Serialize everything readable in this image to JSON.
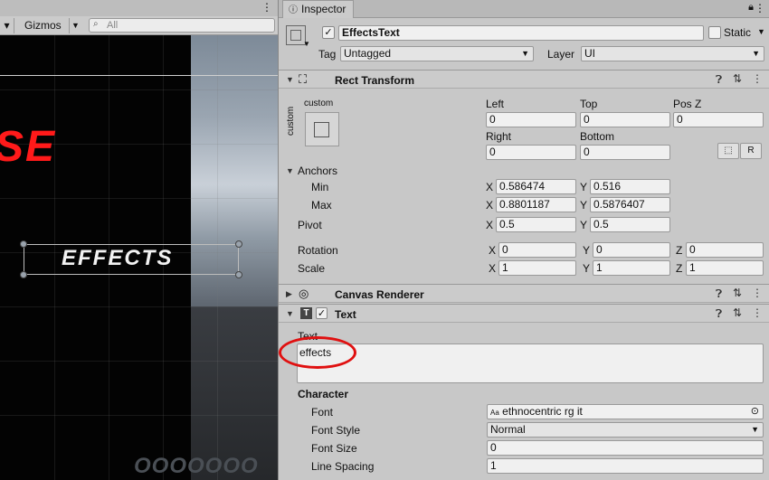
{
  "scene": {
    "gizmos_label": "Gizmos",
    "search_placeholder": "All",
    "big_word": "SE",
    "effects_word": "EFFECTS",
    "bottom_text": "OOOOOOO"
  },
  "inspector": {
    "tab_label": "Inspector",
    "object_name": "EffectsText",
    "static_label": "Static",
    "tag_label": "Tag",
    "tag_value": "Untagged",
    "layer_label": "Layer",
    "layer_value": "UI",
    "rect_transform": {
      "title": "Rect Transform",
      "anchor_preset_top": "custom",
      "anchor_preset_side": "custom",
      "left_label": "Left",
      "left": "0",
      "top_label": "Top",
      "top": "0",
      "posz_label": "Pos Z",
      "posz": "0",
      "right_label": "Right",
      "right": "0",
      "bottom_label": "Bottom",
      "bottom": "0",
      "r_button": "R",
      "anchors_label": "Anchors",
      "min_label": "Min",
      "min_x": "0.586474",
      "min_y": "0.516",
      "max_label": "Max",
      "max_x": "0.8801187",
      "max_y": "0.5876407",
      "pivot_label": "Pivot",
      "pivot_x": "0.5",
      "pivot_y": "0.5",
      "rotation_label": "Rotation",
      "rot_x": "0",
      "rot_y": "0",
      "rot_z": "0",
      "scale_label": "Scale",
      "scale_x": "1",
      "scale_y": "1",
      "scale_z": "1",
      "x": "X",
      "y": "Y",
      "z": "Z"
    },
    "canvas_renderer": {
      "title": "Canvas Renderer"
    },
    "text_component": {
      "title": "Text",
      "text_label": "Text",
      "text_value": "effects",
      "character_label": "Character",
      "font_label": "Font",
      "font_value": "ethnocentric rg it",
      "font_style_label": "Font Style",
      "font_style_value": "Normal",
      "font_size_label": "Font Size",
      "font_size_value": "0",
      "line_spacing_label": "Line Spacing",
      "line_spacing_value": "1"
    }
  },
  "colors": {
    "highlight_circle": "#e01010",
    "title_red": "#ff1a1a"
  }
}
